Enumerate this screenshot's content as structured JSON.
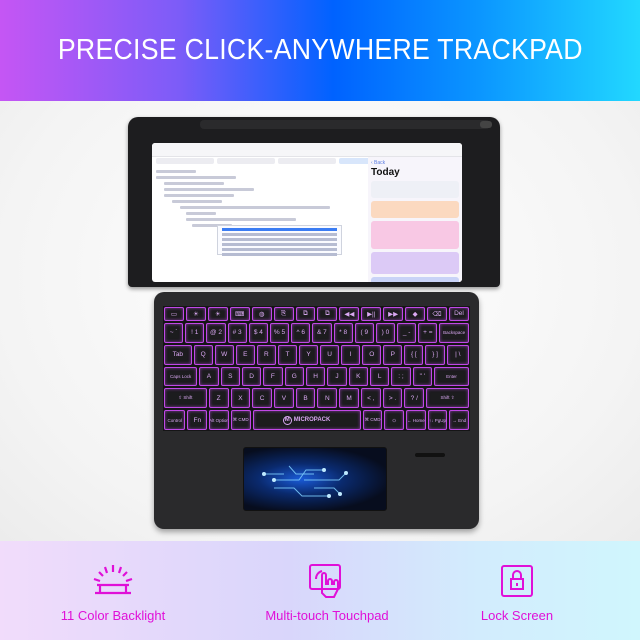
{
  "header": {
    "title": "PRECISE CLICK-ANYWHERE TRACKPAD"
  },
  "screen": {
    "sidebar_back": "‹ Back",
    "sidebar_title": "Today"
  },
  "keyboard": {
    "brand": "MICROPACK",
    "backlight_color": "#c048e6",
    "rows": [
      [
        "▭",
        "☀",
        "☀",
        "⌨",
        "◍",
        "⎘",
        "⧉",
        "⧉",
        "◀◀",
        "▶||",
        "▶▶",
        "◆",
        "⌫",
        "Del"
      ],
      [
        "~ `",
        "! 1",
        "@ 2",
        "# 3",
        "$ 4",
        "% 5",
        "^ 6",
        "& 7",
        "* 8",
        "( 9",
        ") 0",
        "_ -",
        "+ =",
        "Backspace"
      ],
      [
        "Tab",
        "Q",
        "W",
        "E",
        "R",
        "T",
        "Y",
        "U",
        "I",
        "O",
        "P",
        "{ [",
        "} ]",
        "| \\"
      ],
      [
        "Caps Lock",
        "A",
        "S",
        "D",
        "F",
        "G",
        "H",
        "J",
        "K",
        "L",
        ": ;",
        "\" '",
        "Enter"
      ],
      [
        "⇧ Shift",
        "Z",
        "X",
        "C",
        "V",
        "B",
        "N",
        "M",
        "< ,",
        "> .",
        "? /",
        "Shift ⇧"
      ],
      [
        "Control",
        "Fn",
        "Alt Option",
        "⌘ CMD",
        "SPACE",
        "⌘ CMD",
        "☼",
        "← Home",
        "↑↓ PgUp",
        "→ End"
      ]
    ]
  },
  "features": [
    {
      "icon": "backlight-icon",
      "label": "11 Color Backlight"
    },
    {
      "icon": "touchpad-gesture-icon",
      "label": "Multi-touch Touchpad"
    },
    {
      "icon": "lock-icon",
      "label": "Lock Screen"
    }
  ],
  "colors": {
    "accent": "#e010d8"
  }
}
